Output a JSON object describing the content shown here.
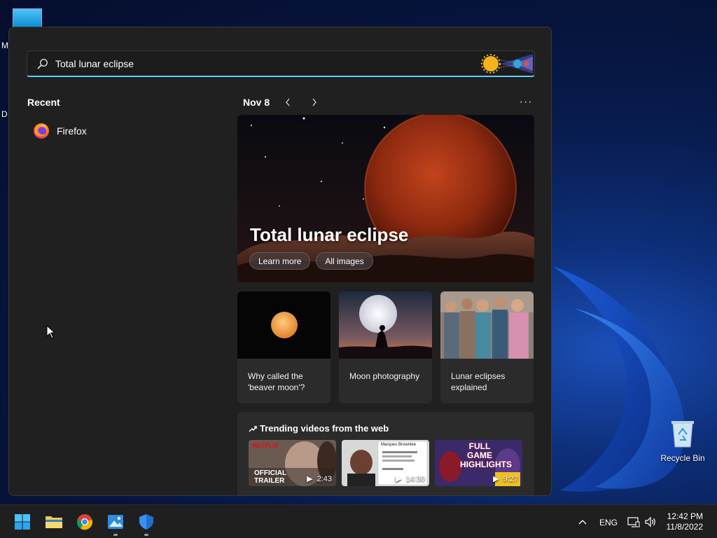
{
  "desktop": {
    "partial_label_1": "M",
    "partial_label_2": "D",
    "recycle_bin_label": "Recycle Bin"
  },
  "search": {
    "value": "Total lunar eclipse",
    "placeholder": "Total lunar eclipse"
  },
  "recent": {
    "title": "Recent",
    "items": [
      {
        "label": "Firefox",
        "icon": "firefox-icon"
      }
    ]
  },
  "highlights": {
    "date": "Nov 8",
    "prev_icon": "chevron-left-icon",
    "next_icon": "chevron-right-icon",
    "more_label": "···",
    "hero": {
      "title": "Total lunar eclipse",
      "buttons": [
        "Learn more",
        "All images"
      ]
    },
    "cards": [
      {
        "caption": "Why called the 'beaver moon'?"
      },
      {
        "caption": "Moon photography"
      },
      {
        "caption": "Lunar eclipses explained"
      }
    ],
    "trending": {
      "title": "Trending videos from the web",
      "icon": "trending-arrow-icon",
      "videos": [
        {
          "duration": "2:43",
          "overlay_text": "OFFICIAL TRAILER",
          "brand": "NETFLIX"
        },
        {
          "duration": "14:30",
          "overlay_text": "Marques Brownlee"
        },
        {
          "duration": "9:27",
          "overlay_text": "FULL GAME HIGHLIGHTS"
        }
      ]
    }
  },
  "taskbar": {
    "apps": [
      "start-button",
      "file-explorer",
      "chrome",
      "photos",
      "windows-security"
    ],
    "language": "ENG",
    "time": "12:42 PM",
    "date": "11/8/2022"
  },
  "colors": {
    "accent": "#60cdff",
    "panel_bg": "#202020",
    "card_bg": "#2b2b2b"
  }
}
